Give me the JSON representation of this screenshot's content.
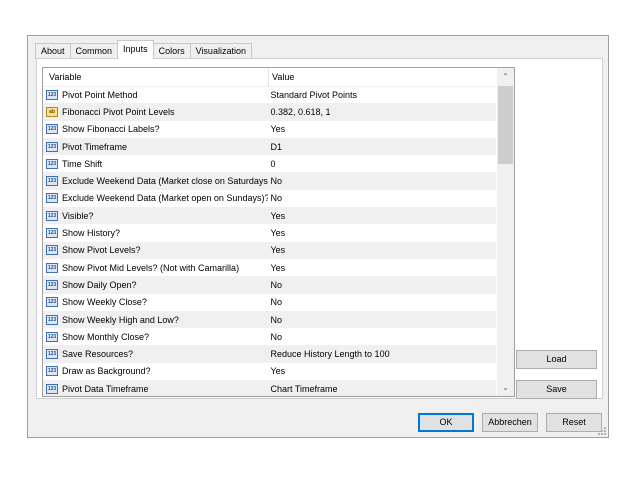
{
  "tabs": [
    {
      "label": "About"
    },
    {
      "label": "Common"
    },
    {
      "label": "Inputs",
      "active": true
    },
    {
      "label": "Colors"
    },
    {
      "label": "Visualization"
    }
  ],
  "grid": {
    "columns": {
      "variable": "Variable",
      "value": "Value"
    },
    "rows": [
      {
        "icon": "123",
        "variable": "Pivot Point Method",
        "value": "Standard Pivot Points"
      },
      {
        "icon": "ab",
        "variable": "Fibonacci Pivot Point Levels",
        "value": "0.382, 0.618, 1"
      },
      {
        "icon": "123",
        "variable": "Show Fibonacci Labels?",
        "value": "Yes"
      },
      {
        "icon": "123",
        "variable": "Pivot Timeframe",
        "value": "D1"
      },
      {
        "icon": "123",
        "variable": "Time Shift",
        "value": "0"
      },
      {
        "icon": "123",
        "variable": "Exclude Weekend Data (Market close on Saturdays)?",
        "value": "No"
      },
      {
        "icon": "123",
        "variable": "Exclude Weekend Data (Market open on Sundays)?",
        "value": "No"
      },
      {
        "icon": "123",
        "variable": "Visible?",
        "value": "Yes"
      },
      {
        "icon": "123",
        "variable": "Show History?",
        "value": "Yes"
      },
      {
        "icon": "123",
        "variable": "Show Pivot Levels?",
        "value": "Yes"
      },
      {
        "icon": "123",
        "variable": "Show Pivot Mid Levels? (Not with Camarilla)",
        "value": "Yes"
      },
      {
        "icon": "123",
        "variable": "Show Daily Open?",
        "value": "No"
      },
      {
        "icon": "123",
        "variable": "Show Weekly Close?",
        "value": "No"
      },
      {
        "icon": "123",
        "variable": "Show Weekly High and Low?",
        "value": "No"
      },
      {
        "icon": "123",
        "variable": "Show Monthly Close?",
        "value": "No"
      },
      {
        "icon": "123",
        "variable": "Save Resources?",
        "value": "Reduce History Length to 100"
      },
      {
        "icon": "123",
        "variable": "Draw as Background?",
        "value": "Yes"
      },
      {
        "icon": "123",
        "variable": "Pivot Data Timeframe",
        "value": "Chart Timeframe"
      }
    ]
  },
  "side_buttons": {
    "load": "Load",
    "save": "Save"
  },
  "footer_buttons": {
    "ok": "OK",
    "cancel": "Abbrechen",
    "reset": "Reset"
  },
  "icons": {
    "scroll_up": "chevron-up-icon",
    "scroll_down": "chevron-down-icon"
  },
  "colors": {
    "default_button_border": "#0078d7",
    "alt_row": "#f0f0f0"
  }
}
